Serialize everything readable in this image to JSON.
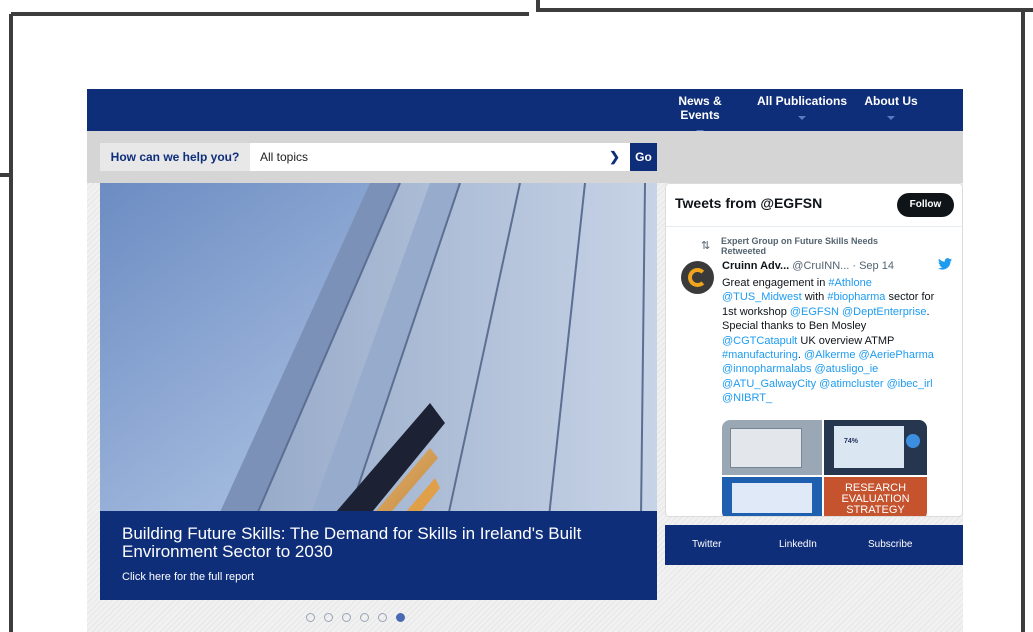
{
  "nav": {
    "items": [
      {
        "label": "News & Events"
      },
      {
        "label": "All Publications"
      },
      {
        "label": "About Us"
      }
    ]
  },
  "search": {
    "label": "How can we help you?",
    "selected": "All topics",
    "go_label": "Go"
  },
  "hero": {
    "title": "Building Future Skills: The Demand for Skills in Ireland's Built Environment Sector to 2030",
    "link": "Click here for the full report",
    "slide_count": 6,
    "active_slide": 6
  },
  "twitter": {
    "title": "Tweets from @EGFSN",
    "follow_label": "Follow",
    "retweet_text": "Expert Group on Future Skills Needs Retweeted",
    "author_name": "Cruinn Adv...",
    "author_handle": "@CruINN...",
    "date": "· Sep 14",
    "body": {
      "t1": "Great engagement in ",
      "h1": "#Athlone",
      "h2": "@TUS_Midwest",
      "t2": " with ",
      "h3": "#biopharma",
      "t3": " sector for 1st workshop ",
      "h4": "@EGFSN",
      "h5": "@DeptEnterprise",
      "t4": ". Special thanks to Ben Mosley ",
      "h6": "@CGTCatapult",
      "t5": " UK overview ATMP ",
      "h7": "#manufacturing",
      "t6": ". ",
      "h8": "@Alkerme",
      "h9": "@AeriePharma",
      "h10": "@innopharmalabs",
      "h11": "@atusligo_ie",
      "h12": "@ATU_GalwayCity",
      "h13": "@atimcluster",
      "h14": "@ibec_irl",
      "h15": "@NIBRT_"
    },
    "media_text": {
      "pct": "74%",
      "line1": "RESEARCH",
      "line2": "EVALUATION",
      "line3": "STRATEGY"
    }
  },
  "share": {
    "twitter": "Twitter",
    "linkedin": "LinkedIn",
    "subscribe": "Subscribe"
  },
  "colors": {
    "brand_navy": "#0f2e7a",
    "twitter_blue": "#1d9bf0",
    "active_dot": "#4a6bb2"
  }
}
